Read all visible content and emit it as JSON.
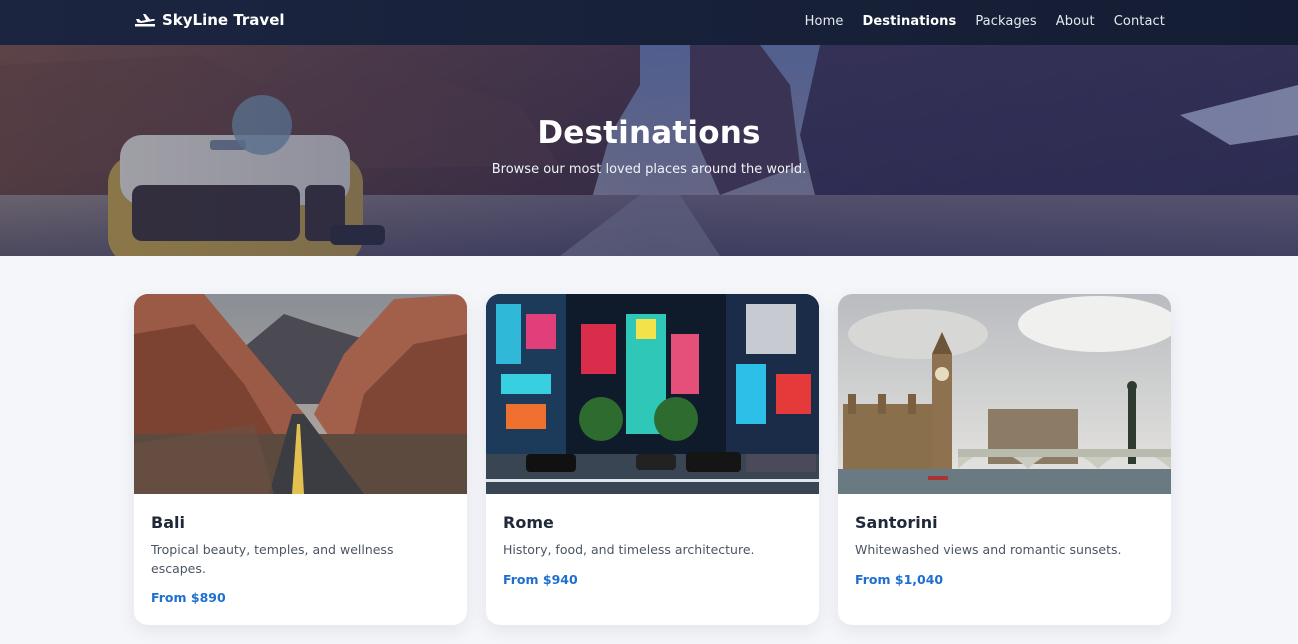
{
  "nav": {
    "brand": "SkyLine Travel",
    "brand_icon": "plane-icon",
    "links": [
      {
        "label": "Home",
        "active": false
      },
      {
        "label": "Destinations",
        "active": true
      },
      {
        "label": "Packages",
        "active": false
      },
      {
        "label": "About",
        "active": false
      },
      {
        "label": "Contact",
        "active": false
      }
    ]
  },
  "hero": {
    "title": "Destinations",
    "subtitle": "Browse our most loved places around the world."
  },
  "cards": [
    {
      "title": "Bali",
      "description": "Tropical beauty, temples, and wellness escapes.",
      "price": "From $890",
      "image": "desert-road-photo"
    },
    {
      "title": "Rome",
      "description": "History, food, and timeless architecture.",
      "price": "From $940",
      "image": "neon-city-street-photo"
    },
    {
      "title": "Santorini",
      "description": "Whitewashed views and romantic sunsets.",
      "price": "From $1,040",
      "image": "big-ben-bridge-photo"
    }
  ],
  "colors": {
    "nav_bg": "#1b2540",
    "accent_price": "#1e6fd0",
    "page_bg": "#f4f6fa"
  }
}
